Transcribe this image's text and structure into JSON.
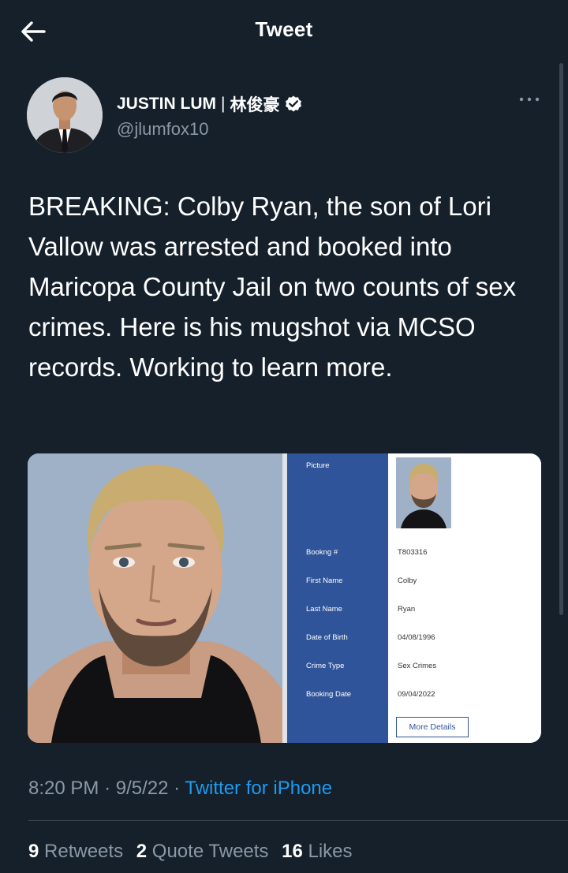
{
  "header": {
    "title": "Tweet",
    "back_icon": "arrow-left-icon"
  },
  "author": {
    "display_name": "JUSTIN LUM",
    "name_separator": "|",
    "name_chinese": "林俊豪",
    "handle": "@jlumfox10",
    "verified": true
  },
  "tweet": {
    "text": "BREAKING: Colby Ryan, the son of Lori Vallow was arrested and booked into Maricopa County Jail on two counts of sex crimes. Here is his mugshot via MCSO records. Working to learn more."
  },
  "records": {
    "picture_label": "Picture",
    "rows": [
      {
        "label": "Bookng #",
        "value": "T803316"
      },
      {
        "label": "First Name",
        "value": "Colby"
      },
      {
        "label": "Last Name",
        "value": "Ryan"
      },
      {
        "label": "Date of Birth",
        "value": "04/08/1996"
      },
      {
        "label": "Crime Type",
        "value": "Sex Crimes"
      },
      {
        "label": "Booking Date",
        "value": "09/04/2022"
      }
    ],
    "button_label": "More Details"
  },
  "meta": {
    "time": "8:20 PM",
    "date": "9/5/22",
    "separator": "·",
    "source": "Twitter for iPhone"
  },
  "stats": {
    "retweets_count": "9",
    "retweets_label": "Retweets",
    "quotes_count": "2",
    "quotes_label": "Quote Tweets",
    "likes_count": "16",
    "likes_label": "Likes"
  },
  "colors": {
    "background": "#15202b",
    "link": "#1d9bf0",
    "muted": "#8b98a5",
    "record_panel": "#2f5499"
  }
}
